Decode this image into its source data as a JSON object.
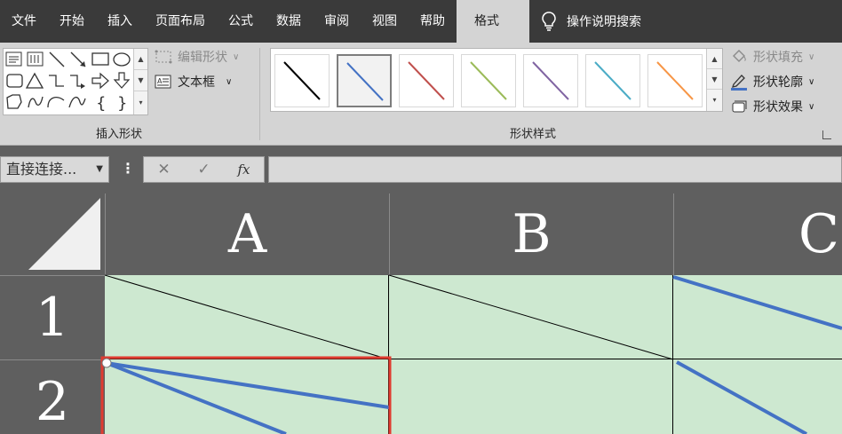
{
  "menu": {
    "tabs": [
      "文件",
      "开始",
      "插入",
      "页面布局",
      "公式",
      "数据",
      "审阅",
      "视图",
      "帮助",
      "格式"
    ],
    "active_tab": "格式",
    "tell_me": "操作说明搜索"
  },
  "ribbon": {
    "insert_shapes": {
      "label": "插入形状",
      "edit_shape": "编辑形状",
      "text_box": "文本框"
    },
    "shape_styles": {
      "label": "形状样式",
      "swatch_colors": [
        "#000000",
        "#4472c4",
        "#c0504d",
        "#9bbb59",
        "#8064a2",
        "#4bacc6",
        "#f79646"
      ],
      "selected_index": 1
    },
    "shape_fill": "形状填充",
    "shape_outline": "形状轮廓",
    "shape_effects": "形状效果"
  },
  "formula_bar": {
    "name_box": "直接连接...",
    "cancel_icon": "✕",
    "enter_icon": "✓",
    "fx_label": "fx"
  },
  "sheet": {
    "columns": [
      "A",
      "B",
      "C"
    ],
    "rows": [
      "1",
      "2"
    ],
    "cell_fill": "#cde8d0",
    "line_color": "#4472c4",
    "selection_color": "#e03c31"
  }
}
